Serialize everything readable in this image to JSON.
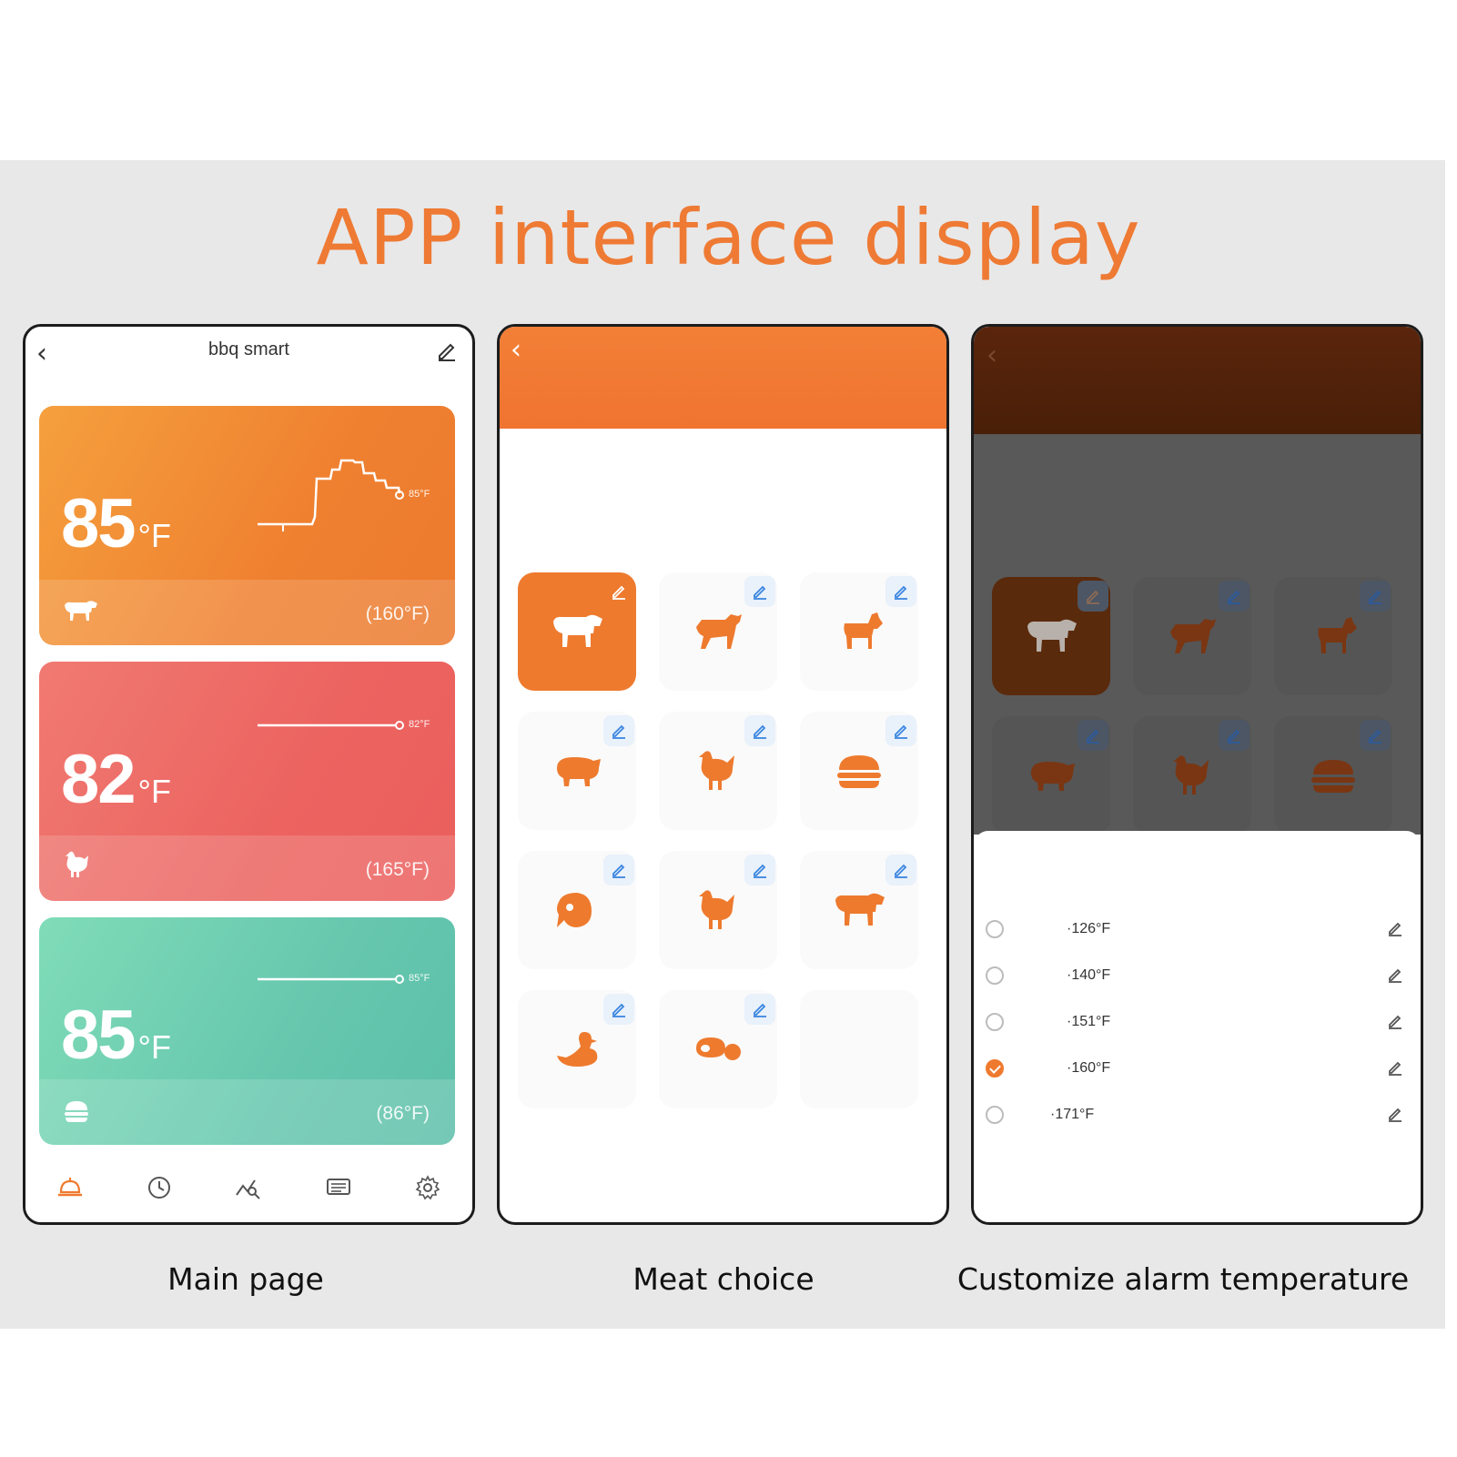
{
  "title": "APP interface display",
  "captions": [
    "Main page",
    "Meat choice",
    "Customize alarm temperature"
  ],
  "colors": {
    "accent": "#ee7a34",
    "orange_card": "#ef8030",
    "red_card": "#ec6360",
    "green_card": "#66c7ae",
    "pen_blue": "#3a86e0"
  },
  "main_page": {
    "back_icon": "chevron-left-icon",
    "app_title": "bbq smart",
    "edit_icon": "pen-icon",
    "cards": [
      {
        "temp": "85",
        "unit": "°F",
        "graph_label": "85°F",
        "target": "(160°F)",
        "meat_icon": "cow-icon"
      },
      {
        "temp": "82",
        "unit": "°F",
        "graph_label": "82°F",
        "target": "(165°F)",
        "meat_icon": "chicken-icon"
      },
      {
        "temp": "85",
        "unit": "°F",
        "graph_label": "85°F",
        "target": "(86°F)",
        "meat_icon": "burger-icon"
      }
    ],
    "tabs": [
      "bell-icon",
      "clock-icon",
      "chart-icon",
      "list-icon",
      "settings-icon"
    ]
  },
  "meat_choice": {
    "back_icon": "chevron-left-icon",
    "tiles": [
      "cow",
      "bull",
      "goat",
      "pig",
      "chicken",
      "burger",
      "fish",
      "chicken",
      "cow",
      "duck",
      "steak",
      "empty"
    ]
  },
  "alarm": {
    "options": [
      {
        "value": "·126°F",
        "checked": false
      },
      {
        "value": "·140°F",
        "checked": false
      },
      {
        "value": "·151°F",
        "checked": false
      },
      {
        "value": "·160°F",
        "checked": true
      },
      {
        "value": "·171°F",
        "checked": false
      }
    ]
  }
}
